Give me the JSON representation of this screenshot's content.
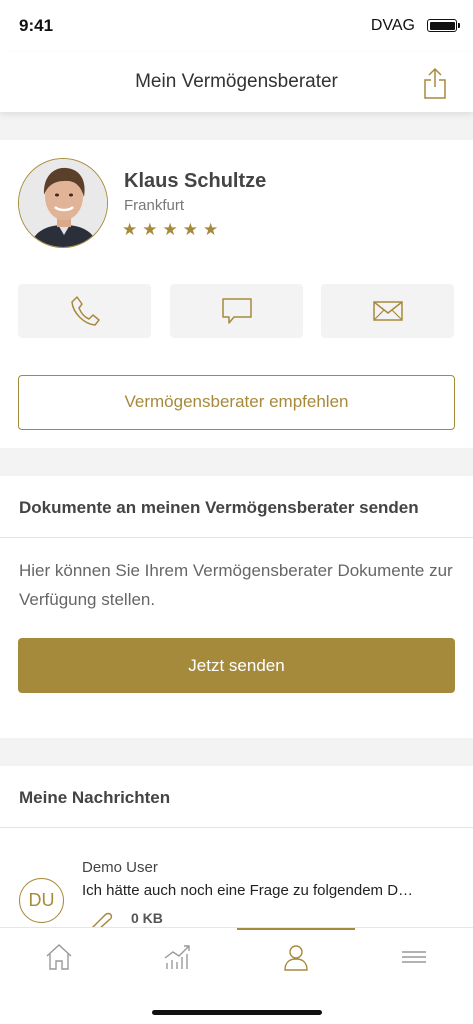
{
  "status_bar": {
    "time": "9:41",
    "carrier": "DVAG"
  },
  "nav": {
    "title": "Mein Vermögensberater",
    "share_icon": "share-icon"
  },
  "advisor": {
    "name": "Klaus Schultze",
    "city": "Frankfurt",
    "stars": "★★★★★",
    "rating": 5,
    "contact": {
      "phone_icon": "phone-icon",
      "chat_icon": "chat-icon",
      "mail_icon": "mail-icon"
    },
    "recommend_label": "Vermögensberater empfehlen"
  },
  "documents": {
    "title": "Dokumente an meinen Vermögensberater senden",
    "description": "Hier können Sie Ihrem Vermögensberater Dokumente zur Verfügung stellen.",
    "send_label": "Jetzt senden"
  },
  "messages": {
    "title": "Meine Nachrichten",
    "items": [
      {
        "initials": "DU",
        "sender": "Demo User",
        "preview": "Ich hätte auch noch eine Frage zu folgendem D…",
        "attachment": "0 KB"
      }
    ]
  },
  "tab_bar": {
    "tabs": [
      {
        "icon": "home-icon"
      },
      {
        "icon": "chart-icon"
      },
      {
        "icon": "person-icon",
        "active": true
      },
      {
        "icon": "menu-icon"
      }
    ]
  },
  "colors": {
    "accent": "#a68a3c",
    "background_gray": "#f3f3f3",
    "text": "#333333"
  }
}
